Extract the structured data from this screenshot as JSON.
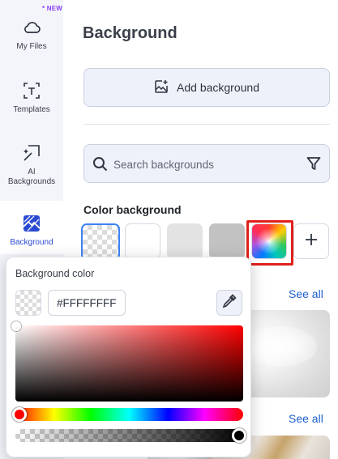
{
  "rail": {
    "new_badge": "* NEW",
    "items": [
      {
        "label": "My Files",
        "icon": "cloud-icon"
      },
      {
        "label": "Templates",
        "icon": "templates-icon"
      },
      {
        "label": "AI\nBackgrounds",
        "icon": "ai-wand-icon"
      },
      {
        "label": "Background",
        "icon": "background-icon",
        "active": true
      }
    ]
  },
  "panel": {
    "title": "Background",
    "add_background_label": "Add background",
    "search": {
      "placeholder": "Search backgrounds"
    },
    "color_section_title": "Color background",
    "swatches": [
      {
        "kind": "transparent",
        "selected": true
      },
      {
        "kind": "solid",
        "color": "#ffffff"
      },
      {
        "kind": "solid",
        "color": "#e3e3e3"
      },
      {
        "kind": "solid",
        "color": "#c2c2c2"
      },
      {
        "kind": "custom-color"
      },
      {
        "kind": "add"
      }
    ],
    "see_all_label": "See all"
  },
  "color_picker": {
    "title": "Background color",
    "hex_value": "#FFFFFFFF",
    "hue": "#ff0000"
  },
  "colors": {
    "accent": "#2a4ad0",
    "link": "#1d5fd1",
    "highlight": "#e0201b",
    "new_badge": "#8a3ff0"
  }
}
